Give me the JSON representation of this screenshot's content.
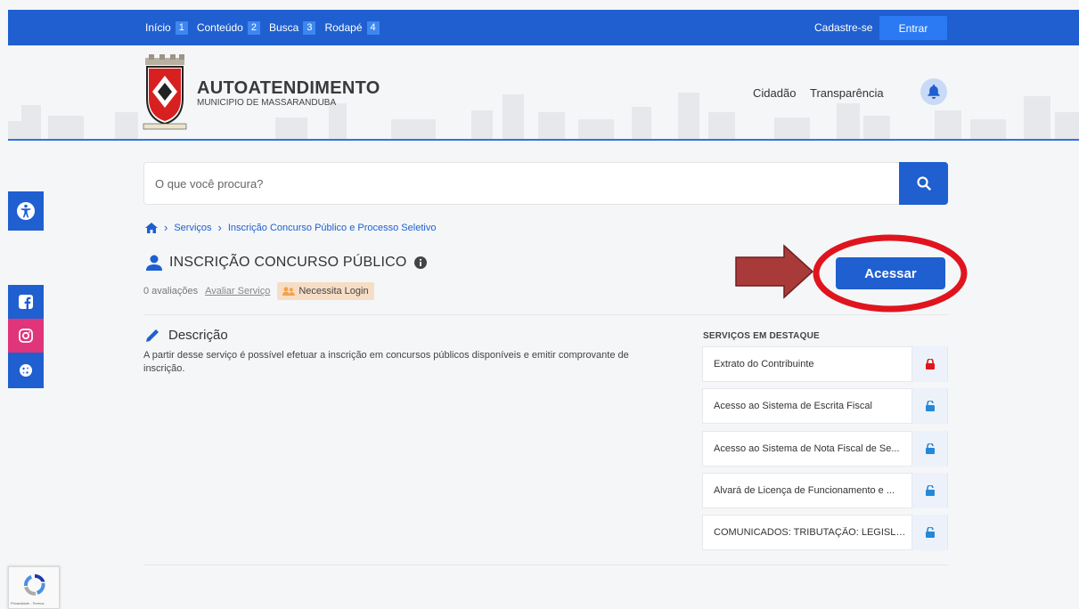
{
  "topbar": {
    "links": [
      {
        "label": "Início",
        "num": "1"
      },
      {
        "label": "Conteúdo",
        "num": "2"
      },
      {
        "label": "Busca",
        "num": "3"
      },
      {
        "label": "Rodapé",
        "num": "4"
      }
    ],
    "cadastre": "Cadastre-se",
    "entrar": "Entrar",
    "bg_color": "#1f5fd0"
  },
  "header": {
    "title": "AUTOATENDIMENTO",
    "subtitle": "MUNICIPIO DE MASSARANDUBA",
    "nav": [
      "Cidadão",
      "Transparência"
    ]
  },
  "search": {
    "placeholder": "O que você procura?"
  },
  "breadcrumb": [
    "Serviços",
    "Inscrição Concurso Público e Processo Seletivo"
  ],
  "service": {
    "title": "INSCRIÇÃO CONCURSO PÚBLICO",
    "ratings": "0 avaliações",
    "rate_link": "Avaliar Serviço",
    "badge": "Necessita Login",
    "access_button": "Acessar"
  },
  "description": {
    "heading": "Descrição",
    "text": "A partir desse serviço é possível efetuar a inscrição em concursos públicos disponíveis e emitir comprovante de inscrição."
  },
  "featured": {
    "heading": "SERVIÇOS EM DESTAQUE",
    "items": [
      {
        "label": "Extrato do Contribuinte",
        "lock": "locked"
      },
      {
        "label": "Acesso ao Sistema de Escrita Fiscal",
        "lock": "unlocked"
      },
      {
        "label": "Acesso ao Sistema de Nota Fiscal de Se...",
        "lock": "unlocked"
      },
      {
        "label": "Alvará de Licença de Funcionamento e ...",
        "lock": "unlocked"
      },
      {
        "label": "COMUNICADOS: TRIBUTAÇÃO: LEGISLA...",
        "lock": "unlocked"
      }
    ]
  },
  "side_buttons": [
    "accessibility-icon",
    "facebook-icon",
    "instagram-icon",
    "cookie-icon"
  ],
  "recaptcha": {
    "text": "Privacidade - Termos"
  },
  "colors": {
    "primary": "#1f5fd0",
    "instagram": "#e0357a",
    "badge": "#f7ddc5",
    "highlight": "#e0141e",
    "arrow": "#a83a3a"
  }
}
